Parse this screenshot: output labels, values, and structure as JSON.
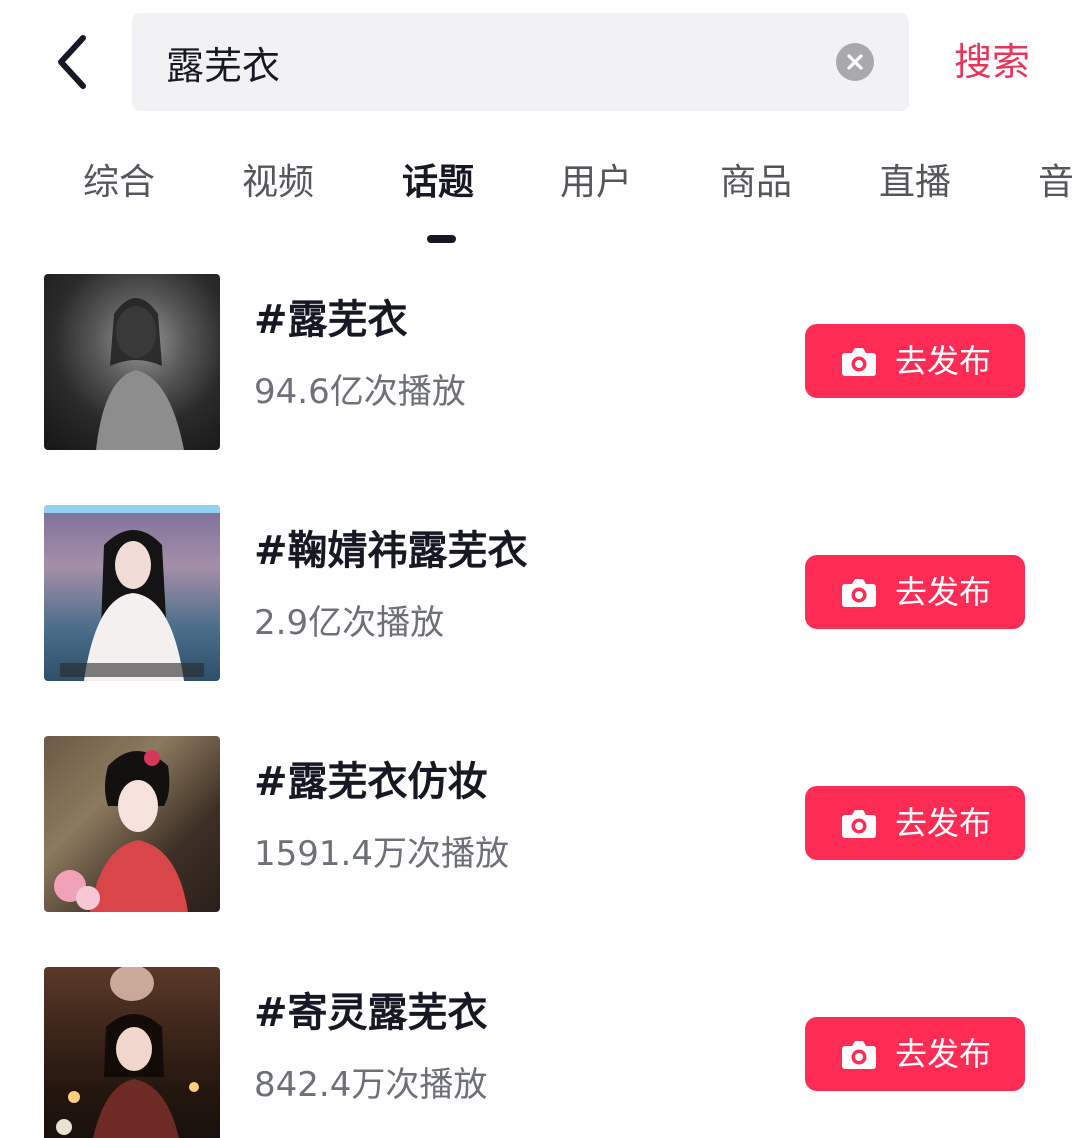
{
  "search": {
    "query": "露芜衣",
    "button_label": "搜索",
    "back_icon": "back-arrow-icon",
    "clear_icon": "clear-icon"
  },
  "tabs": [
    {
      "label": "综合",
      "active": false
    },
    {
      "label": "视频",
      "active": false
    },
    {
      "label": "话题",
      "active": true
    },
    {
      "label": "用户",
      "active": false
    },
    {
      "label": "商品",
      "active": false
    },
    {
      "label": "直播",
      "active": false
    },
    {
      "label": "音",
      "active": false
    }
  ],
  "topics": [
    {
      "title": "#露芜衣",
      "stat": "94.6亿次播放",
      "button_label": "去发布"
    },
    {
      "title": "#鞠婧祎露芜衣",
      "stat": "2.9亿次播放",
      "button_label": "去发布"
    },
    {
      "title": "#露芜衣仿妆",
      "stat": "1591.4万次播放",
      "button_label": "去发布"
    },
    {
      "title": "#寄灵露芜衣",
      "stat": "842.4万次播放",
      "button_label": "去发布"
    }
  ],
  "colors": {
    "accent": "#fe2c55",
    "search_text": "#e8355b",
    "primary_text": "#161823",
    "secondary_text": "#6e7078"
  }
}
